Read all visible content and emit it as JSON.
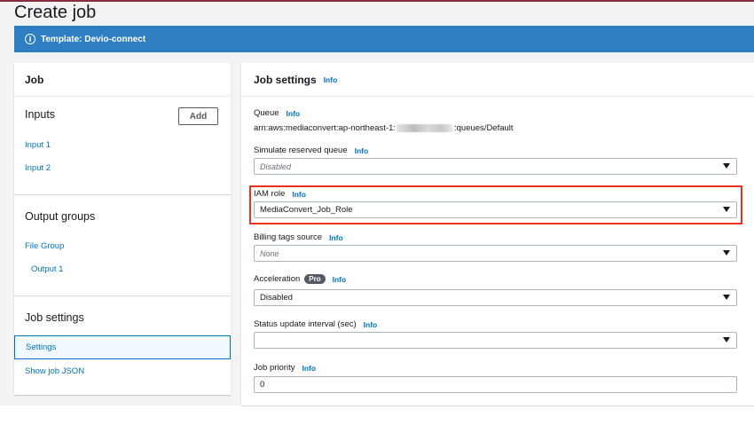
{
  "page": {
    "title": "Create job"
  },
  "banner": {
    "text": "Template: Devio-connect",
    "icon": "info-icon"
  },
  "left_panel": {
    "header": "Job",
    "inputs": {
      "title": "Inputs",
      "add_label": "Add",
      "items": [
        "Input 1",
        "Input 2"
      ]
    },
    "output_groups": {
      "title": "Output groups",
      "group": "File Group",
      "output": "Output 1"
    },
    "job_settings": {
      "title": "Job settings",
      "settings": "Settings",
      "show_json": "Show job JSON"
    }
  },
  "job_settings": {
    "title": "Job settings",
    "info": "Info",
    "queue": {
      "label": "Queue",
      "value_prefix": "arn:aws:mediaconvert:ap-northeast-1:",
      "value_suffix": ":queues/Default"
    },
    "simulate_reserved_queue": {
      "label": "Simulate reserved queue",
      "value": "Disabled"
    },
    "iam_role": {
      "label": "IAM role",
      "value": "MediaConvert_Job_Role"
    },
    "billing_tags_source": {
      "label": "Billing tags source",
      "value": "None"
    },
    "acceleration": {
      "label": "Acceleration",
      "badge": "Pro",
      "value": "Disabled"
    },
    "status_update_interval": {
      "label": "Status update interval (sec)",
      "value": ""
    },
    "job_priority": {
      "label": "Job priority",
      "value": "0"
    }
  },
  "colors": {
    "banner": "#2e7fc1",
    "link": "#0073bb",
    "highlight": "#e8331f"
  }
}
